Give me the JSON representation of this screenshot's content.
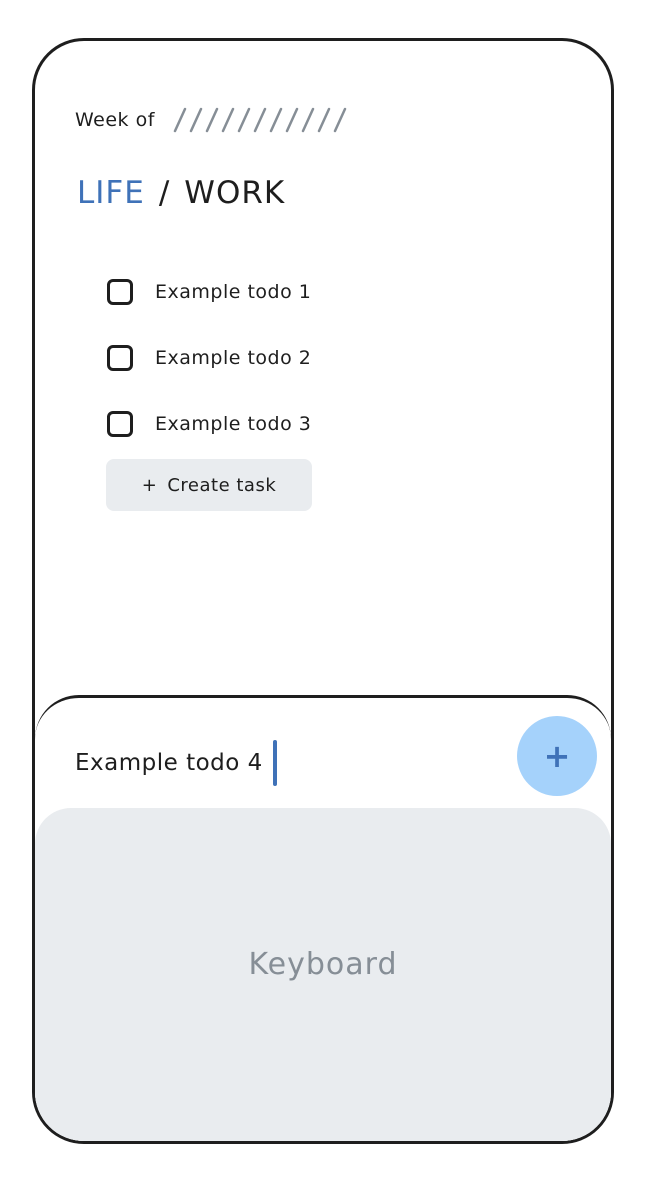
{
  "header": {
    "week_label": "Week of"
  },
  "tabs": {
    "life": "LIFE",
    "separator": "/",
    "work": "WORK",
    "active_color": "#3f72b8"
  },
  "todos": [
    {
      "label": "Example todo 1",
      "checked": false
    },
    {
      "label": "Example todo 2",
      "checked": false
    },
    {
      "label": "Example todo 3",
      "checked": false
    }
  ],
  "create_button": {
    "icon": "+",
    "label": "Create task"
  },
  "new_task": {
    "value": "Example todo 4",
    "add_icon": "+"
  },
  "keyboard": {
    "label": "Keyboard"
  },
  "colors": {
    "accent": "#3f72b8",
    "add_button_bg": "#a5d2fb",
    "panel_gray": "#e9ecef"
  }
}
